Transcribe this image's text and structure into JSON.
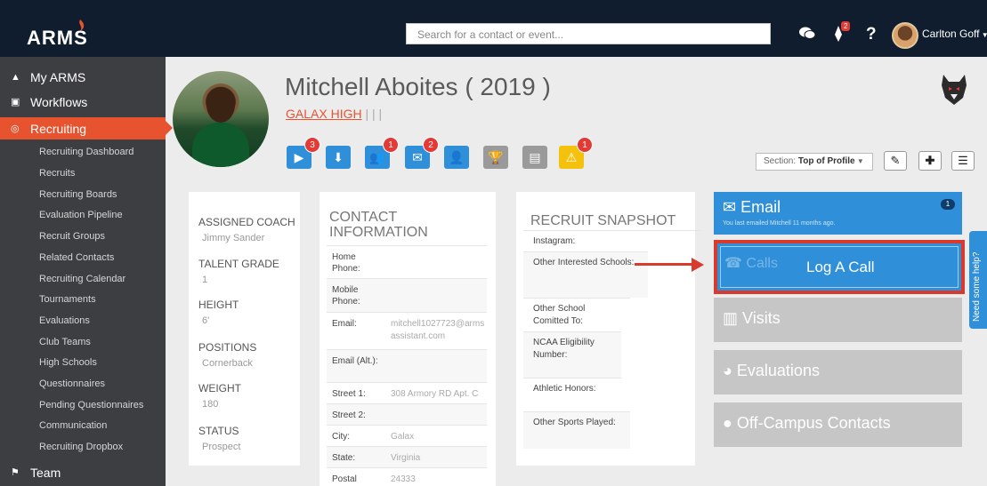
{
  "app": {
    "logo_text": "ARMS"
  },
  "header": {
    "search_placeholder": "Search for a contact or event...",
    "notification_count": "2",
    "help_label": "?",
    "user_name": "Carlton Goff"
  },
  "sidebar": {
    "top_items": [
      {
        "label": "My ARMS",
        "icon": "home-icon"
      },
      {
        "label": "Workflows",
        "icon": "clipboard-icon"
      },
      {
        "label": "Recruiting",
        "icon": "target-icon",
        "active": true
      }
    ],
    "sub_items": [
      "Recruiting Dashboard",
      "Recruits",
      "Recruiting Boards",
      "Evaluation Pipeline",
      "Recruit Groups",
      "Related Contacts",
      "Recruiting Calendar",
      "Tournaments",
      "Evaluations",
      "Club Teams",
      "High Schools",
      "Questionnaires",
      "Pending Questionnaires",
      "Communication",
      "Recruiting Dropbox"
    ],
    "bottom_item": {
      "label": "Team",
      "icon": "flag-icon"
    }
  },
  "profile": {
    "name": "Mitchell Aboites ( 2019 )",
    "school": "GALAX HIGH",
    "school_suffix": " | | |"
  },
  "ribbon": [
    {
      "name": "video-icon",
      "glyph": "▶",
      "color": "#2f8fd8",
      "badge": "3"
    },
    {
      "name": "download-icon",
      "glyph": "⬇",
      "color": "#2f8fd8",
      "badge": ""
    },
    {
      "name": "group-icon",
      "glyph": "👥",
      "color": "#2f8fd8",
      "badge": "1"
    },
    {
      "name": "contact-card-icon",
      "glyph": "✉",
      "color": "#2f8fd8",
      "badge": "2"
    },
    {
      "name": "coach-icon",
      "glyph": "👤",
      "color": "#2f8fd8",
      "badge": ""
    },
    {
      "name": "trophy-icon",
      "glyph": "🏆",
      "color": "#9a9a9a",
      "badge": ""
    },
    {
      "name": "document-icon",
      "glyph": "▤",
      "color": "#9a9a9a",
      "badge": ""
    },
    {
      "name": "warning-icon",
      "glyph": "⚠",
      "color": "#f4c20d",
      "badge": "1"
    }
  ],
  "section_select": {
    "prefix": "Section: ",
    "value": "Top of Profile"
  },
  "summary": {
    "fields": [
      {
        "label": "ASSIGNED COACH",
        "value": "Jimmy Sander"
      },
      {
        "label": "TALENT GRADE",
        "value": "1"
      },
      {
        "label": "HEIGHT",
        "value": "6'"
      },
      {
        "label": "POSITIONS",
        "value": "Cornerback"
      },
      {
        "label": "WEIGHT",
        "value": "180"
      },
      {
        "label": "STATUS",
        "value": "Prospect"
      }
    ]
  },
  "contact": {
    "title": "CONTACT INFORMATION",
    "rows": [
      {
        "key": "Home Phone:",
        "value": ""
      },
      {
        "key": "Mobile Phone:",
        "value": ""
      },
      {
        "key": "Email:",
        "value": "mitchell1027723@armsassistant.com"
      },
      {
        "key": "Email (Alt.):",
        "value": ""
      },
      {
        "key": "Street 1:",
        "value": "308 Armory RD Apt. C"
      },
      {
        "key": "Street 2:",
        "value": ""
      },
      {
        "key": "City:",
        "value": "Galax"
      },
      {
        "key": "State:",
        "value": "Virginia"
      },
      {
        "key": "Postal",
        "value": "24333"
      }
    ]
  },
  "snapshot": {
    "title": "RECRUIT SNAPSHOT",
    "rows": [
      "Instagram:",
      "Other Interested Schools:",
      "Other School Comitted To:",
      "NCAA Eligibility Number:",
      "Athletic Honors:",
      "Other Sports Played:"
    ]
  },
  "actions": {
    "email": {
      "label": "Email",
      "subtext": "You last emailed Mitchell 11 months ago.",
      "count": "1"
    },
    "call": {
      "ghost_label": "Calls",
      "label": "Log A Call"
    },
    "visits": {
      "label": "Visits"
    },
    "evaluations": {
      "label": "Evaluations"
    },
    "offcampus": {
      "label": "Off-Campus Contacts"
    }
  },
  "help_tab": {
    "label": "Need some help?"
  }
}
